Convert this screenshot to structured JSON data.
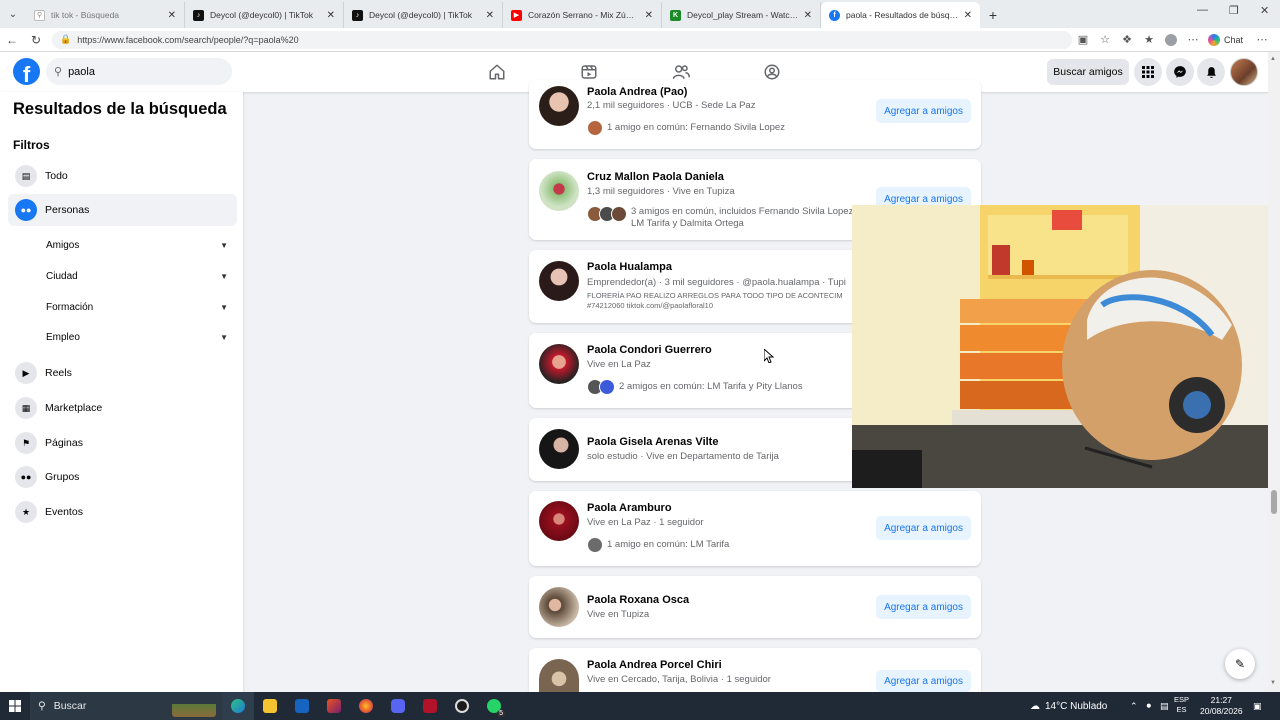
{
  "browser": {
    "tabs": [
      {
        "title": "tik tok - Búsqueda",
        "icon": "search-icon"
      },
      {
        "title": "Deycol (@deycol0) | TikTok",
        "icon": "tiktok-icon"
      },
      {
        "title": "Deycol (@deycol0) | TikTok",
        "icon": "tiktok-icon"
      },
      {
        "title": "Corazón Serrano - Mix Zúmbalo (E",
        "icon": "youtube-icon"
      },
      {
        "title": "Deycol_play Stream - Watch Live o",
        "icon": "kick-icon"
      },
      {
        "title": "paola - Resultados de búsqueda |",
        "icon": "facebook-icon",
        "active": true
      }
    ],
    "url": "https://www.facebook.com/search/people/?q=paola%20",
    "chat_label": "Chat"
  },
  "fb": {
    "search_value": "paola",
    "find_friends_label": "Buscar amigos",
    "logo_letter": "f"
  },
  "sidebar": {
    "title": "Resultados de la búsqueda",
    "filters_label": "Filtros",
    "items": [
      {
        "label": "Todo",
        "icon": "feed-icon"
      },
      {
        "label": "Personas",
        "icon": "people-icon",
        "active": true
      },
      {
        "label": "Reels",
        "icon": "reels-icon"
      },
      {
        "label": "Marketplace",
        "icon": "store-icon"
      },
      {
        "label": "Páginas",
        "icon": "flag-icon"
      },
      {
        "label": "Grupos",
        "icon": "groups-icon"
      },
      {
        "label": "Eventos",
        "icon": "calendar-icon"
      }
    ],
    "subfilters": [
      {
        "label": "Amigos"
      },
      {
        "label": "Ciudad"
      },
      {
        "label": "Formación"
      },
      {
        "label": "Empleo"
      }
    ]
  },
  "results": [
    {
      "name": "Paola Andrea (Pao)",
      "sub": "2,1 mil seguidores · UCB - Sede La Paz",
      "mutual": "1 amigo en común: Fernando Sivila Lopez",
      "button": "Agregar a amigos"
    },
    {
      "name": "Cruz Mallon Paola Daniela",
      "sub": "1,3 mil seguidores · Vive en Tupiza",
      "mutual": "3 amigos en común, incluidos Fernando Sivila Lopez,",
      "mutual2": "LM Tarifa y Dalmita Ortega",
      "button": "Agregar a amigos"
    },
    {
      "name": "Paola Hualampa",
      "sub": "Emprendedor(a) · 3 mil seguidores · @paola.hualampa · Tupi",
      "extra1": "FLORERÍA PAO REALIZO ARREGLOS PARA TODO TIPO DE ACONTECIM",
      "extra2": "#74212060 tiktok.com/@paolafloral10"
    },
    {
      "name": "Paola Condori Guerrero",
      "sub": "Vive en La Paz",
      "mutual": "2 amigos en común: LM Tarifa y Pity Llanos"
    },
    {
      "name": "Paola Gisela Arenas Vilte",
      "sub": "solo estudio · Vive en Departamento de Tarija"
    },
    {
      "name": "Paola Aramburo",
      "sub": "Vive en La Paz · 1 seguidor",
      "mutual": "1 amigo en común: LM Tarifa",
      "button": "Agregar a amigos"
    },
    {
      "name": "Paola Roxana Osca",
      "sub": "Vive en Tupiza",
      "button": "Agregar a amigos"
    },
    {
      "name": "Paola Andrea Porcel Chiri",
      "sub": "Vive en Cercado, Tarija, Bolivia · 1 seguidor",
      "button": "Agregar a amigos"
    }
  ],
  "taskbar": {
    "search_placeholder": "Buscar",
    "weather": "14°C  Nublado",
    "lang1": "ESP",
    "lang2": "ES",
    "time": "21:27",
    "date": "20/08/2026",
    "badge": "5"
  },
  "colors": {
    "accent": "#1877f2",
    "accent_soft": "#e7f3ff",
    "taskbar": "#1f2a36"
  }
}
